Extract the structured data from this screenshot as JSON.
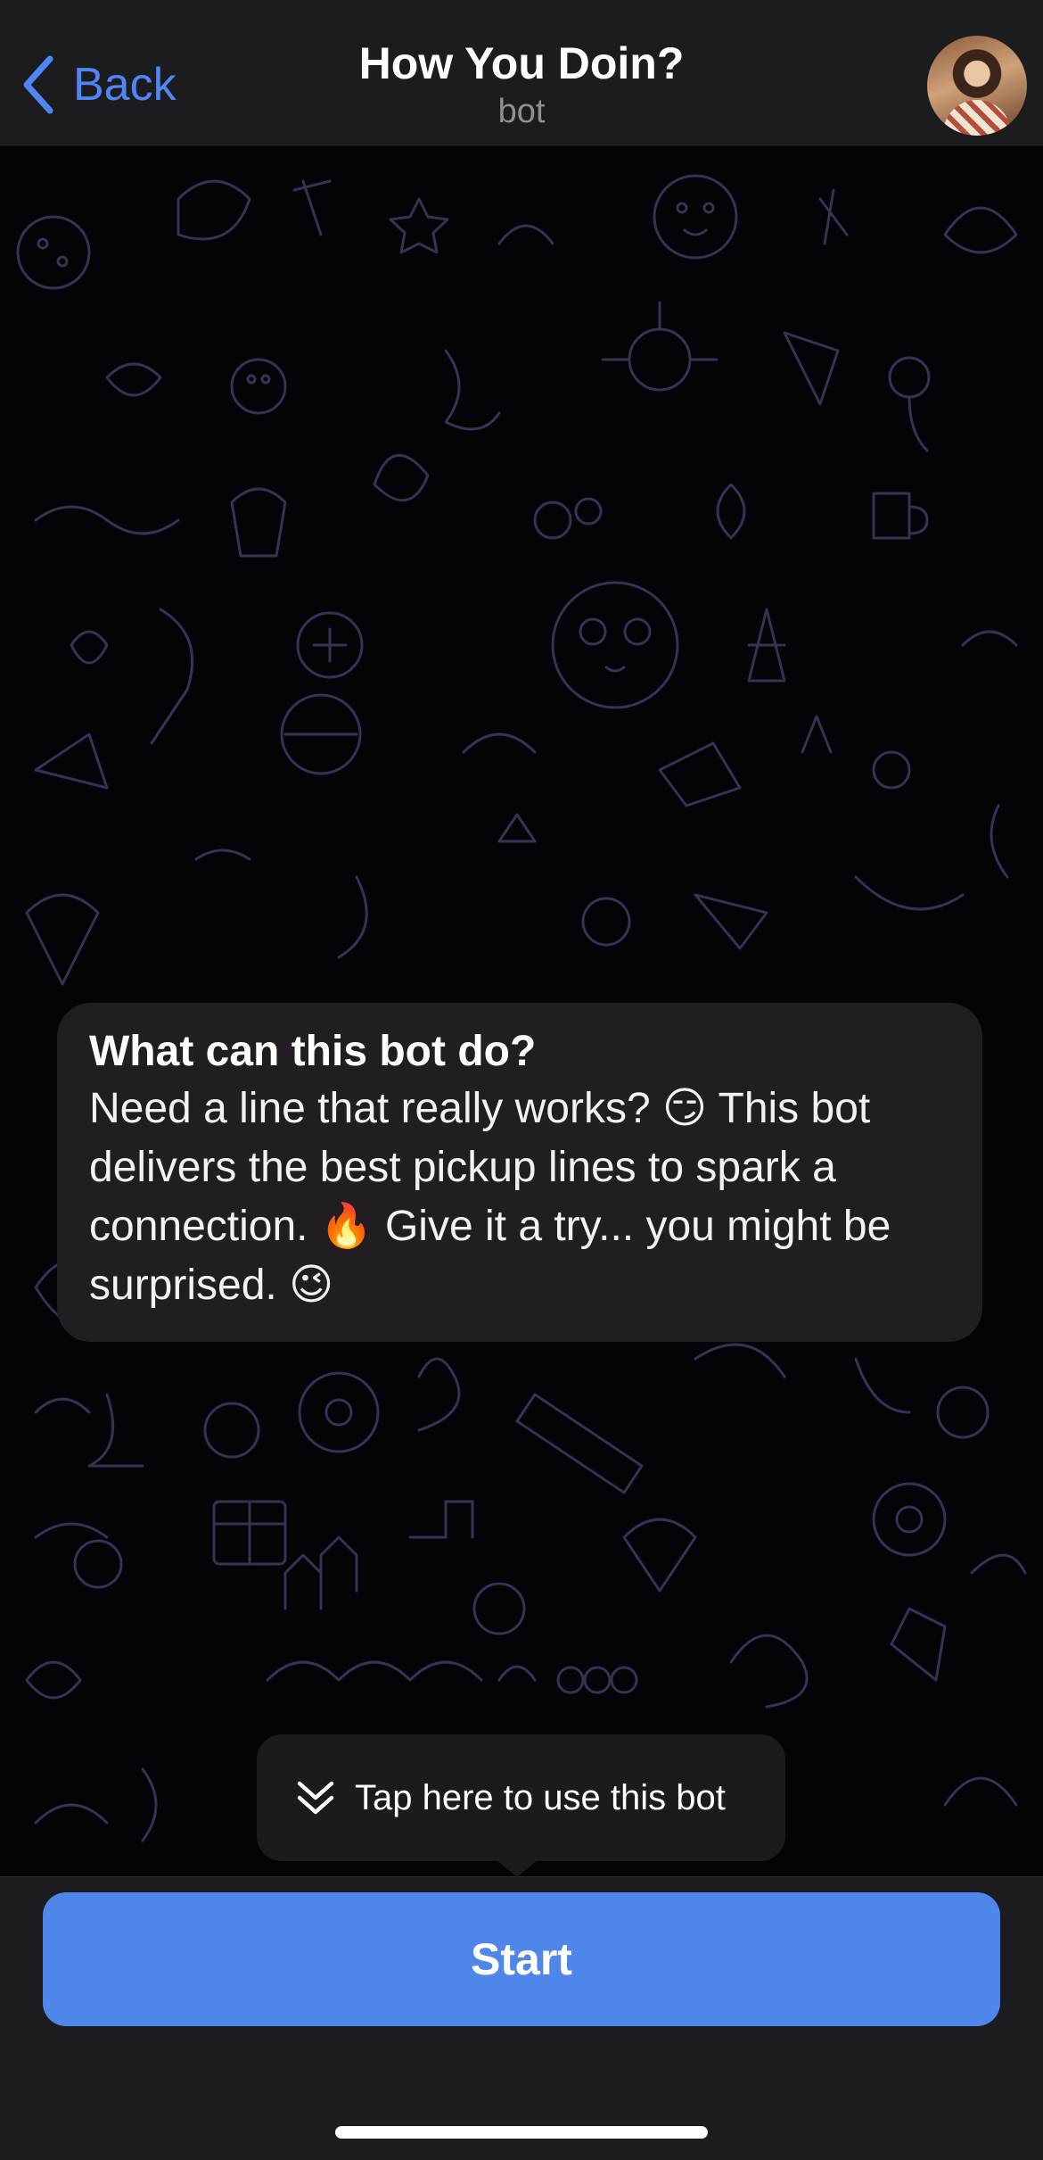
{
  "header": {
    "back_label": "Back",
    "title": "How You Doin?",
    "subtitle": "bot"
  },
  "info_card": {
    "title": "What can this bot do?",
    "body": "Need a line that really works? 😏 This bot delivers the best pickup lines to spark a connection. 🔥 Give it a try... you might be surprised. 😉"
  },
  "tooltip": {
    "text": "Tap here to use this bot",
    "icon": "double-chevron-down-icon"
  },
  "bottom": {
    "start_label": "Start"
  },
  "colors": {
    "accent": "#4f86ea",
    "header_bg": "#1c1c1e",
    "card_bg": "#221d23",
    "doodle": "#3a3050"
  }
}
